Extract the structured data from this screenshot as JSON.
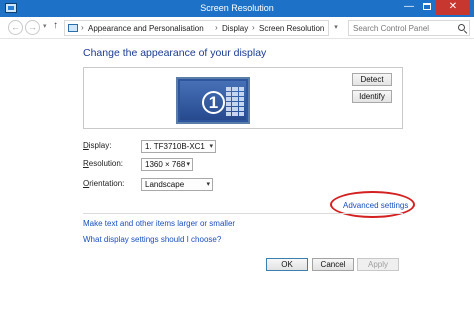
{
  "window": {
    "title": "Screen Resolution",
    "minimize_glyph": "—",
    "close_glyph": "✕"
  },
  "address_bar": {
    "back_glyph": "←",
    "forward_glyph": "→",
    "recent_glyph": "▾",
    "up_glyph": "↑",
    "breadcrumbs": [
      "Appearance and Personalisation",
      "Display",
      "Screen Resolution"
    ],
    "separator": "›",
    "dropdown_glyph": "▾",
    "refresh_glyph": "↻",
    "search_placeholder": "Search Control Panel"
  },
  "main": {
    "heading": "Change the appearance of your display",
    "monitor_number": "1",
    "detect_label": "Detect",
    "identify_label": "Identify",
    "display": {
      "label_accel": "D",
      "label_rest": "isplay:",
      "value": "1. TF3710B-XC1"
    },
    "resolution": {
      "label_accel": "R",
      "label_rest": "esolution:",
      "value": "1360 × 768"
    },
    "orientation": {
      "label_accel": "O",
      "label_rest": "rientation:",
      "value": "Landscape"
    },
    "select_arrow": "▾",
    "advanced_settings_link": "Advanced settings",
    "text_size_link": "Make text and other items larger or smaller",
    "choose_link": "What display settings should I choose?"
  },
  "footer": {
    "ok_label": "OK",
    "cancel_label": "Cancel",
    "apply_label": "Apply"
  },
  "colors": {
    "titlebar": "#1d72c8",
    "heading": "#1c3a94",
    "link": "#1a4fbf",
    "highlight_ring": "#d42020",
    "monitor": "#2e569f"
  },
  "icons": [
    "control-panel-icon",
    "back-arrow-icon",
    "forward-arrow-icon",
    "up-arrow-icon",
    "refresh-icon",
    "search-icon",
    "monitor-icon",
    "display-layout-icon"
  ]
}
